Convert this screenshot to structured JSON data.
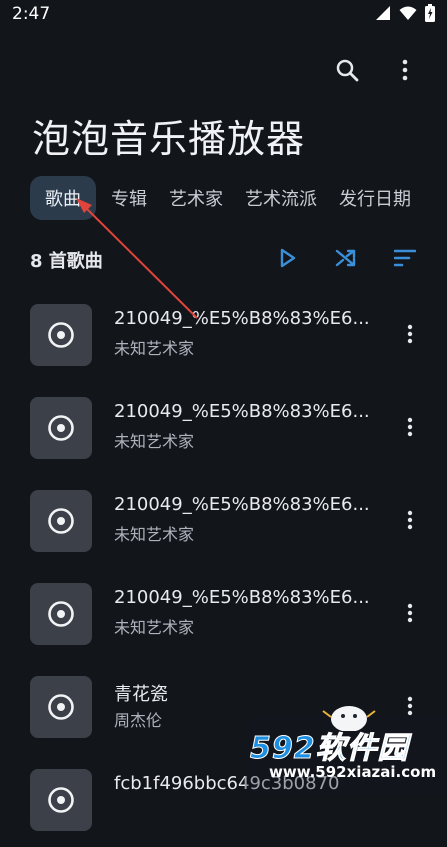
{
  "status": {
    "time": "2:47"
  },
  "app": {
    "title": "泡泡音乐播放器"
  },
  "tabs": [
    {
      "label": "歌曲",
      "active": true
    },
    {
      "label": "专辑"
    },
    {
      "label": "艺术家"
    },
    {
      "label": "艺术流派"
    },
    {
      "label": "发行日期"
    }
  ],
  "list": {
    "count_label": "8 首歌曲"
  },
  "songs": [
    {
      "title": "210049_%E5%B8%83%E6...",
      "artist": "未知艺术家"
    },
    {
      "title": "210049_%E5%B8%83%E6...",
      "artist": "未知艺术家"
    },
    {
      "title": "210049_%E5%B8%83%E6...",
      "artist": "未知艺术家"
    },
    {
      "title": "210049_%E5%B8%83%E6...",
      "artist": "未知艺术家"
    },
    {
      "title": "青花瓷",
      "artist": "周杰伦"
    },
    {
      "title": "fcb1f496bbc649c3b0870",
      "artist": ""
    }
  ],
  "icons": {
    "search": "search-icon",
    "more": "more-vert-icon",
    "play": "play-icon",
    "shuffle": "shuffle-icon",
    "sort": "sort-icon",
    "disc": "disc-icon"
  },
  "colors": {
    "accent": "#3b8fd9",
    "active_tab_bg": "#2c3b4b",
    "background": "#12151a",
    "annotation_arrow": "#e0443a"
  },
  "watermark": {
    "brand": "592软件园",
    "url": "www.592xiazai.com"
  }
}
